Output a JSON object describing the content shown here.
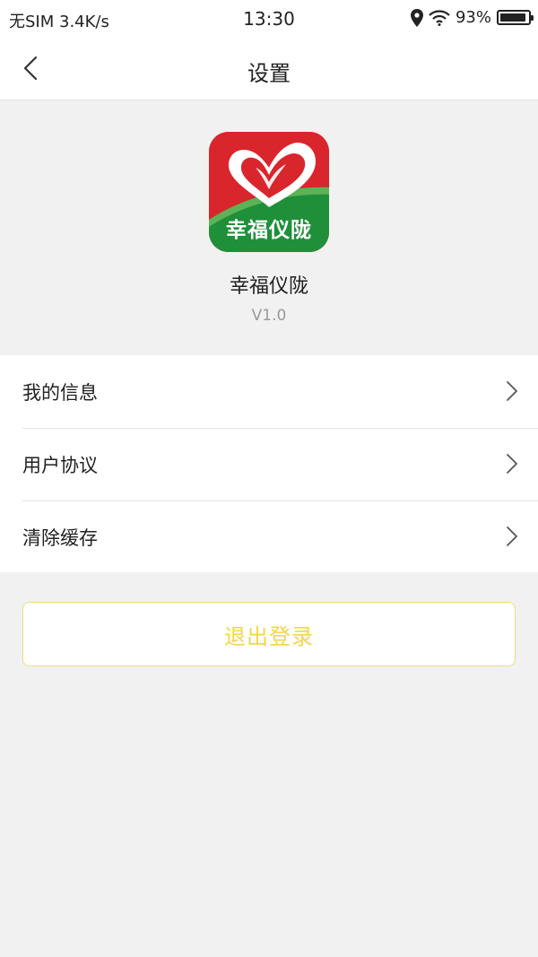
{
  "status_bar": {
    "carrier": "无SIM 3.4K/s",
    "time": "13:30",
    "battery": "93%",
    "battery_level": 0.93,
    "icons": [
      "location-icon",
      "wifi-icon",
      "battery-icon"
    ]
  },
  "nav": {
    "title": "设置",
    "back_icon": "chevron-left-icon"
  },
  "app": {
    "logo_text": "幸福仪陇",
    "name": "幸福仪陇",
    "version": "V1.0",
    "logo_colors": {
      "red": "#d9252c",
      "green": "#1f8f3a",
      "heart": "#ffffff"
    }
  },
  "menu": {
    "items": [
      {
        "label": "我的信息"
      },
      {
        "label": "用户协议"
      },
      {
        "label": "清除缓存"
      }
    ]
  },
  "logout": {
    "label": "退出登录",
    "color": "#f3d54a"
  }
}
